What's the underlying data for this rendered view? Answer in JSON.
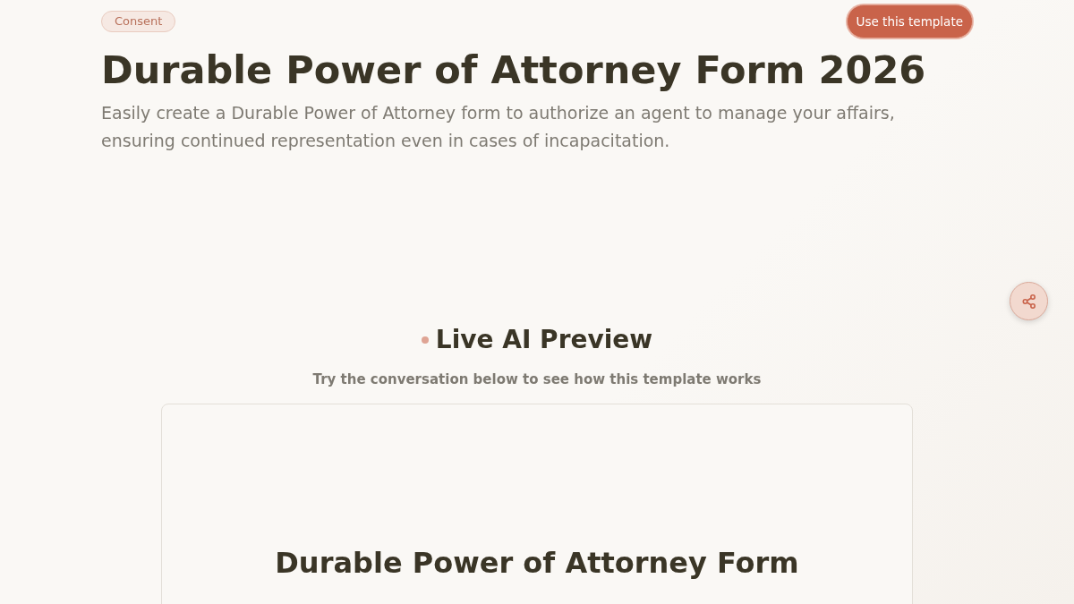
{
  "header": {
    "tag": "Consent",
    "action_button": "Use this template"
  },
  "title": "Durable Power of Attorney Form 2026",
  "description": "Easily create a Durable Power of Attorney form to authorize an agent to manage your affairs, ensuring continued representation even in cases of incapacitation.",
  "preview": {
    "heading": "Live AI Preview",
    "subheading": "Try the conversation below to see how this template works",
    "document_title": "Durable Power of Attorney Form"
  }
}
